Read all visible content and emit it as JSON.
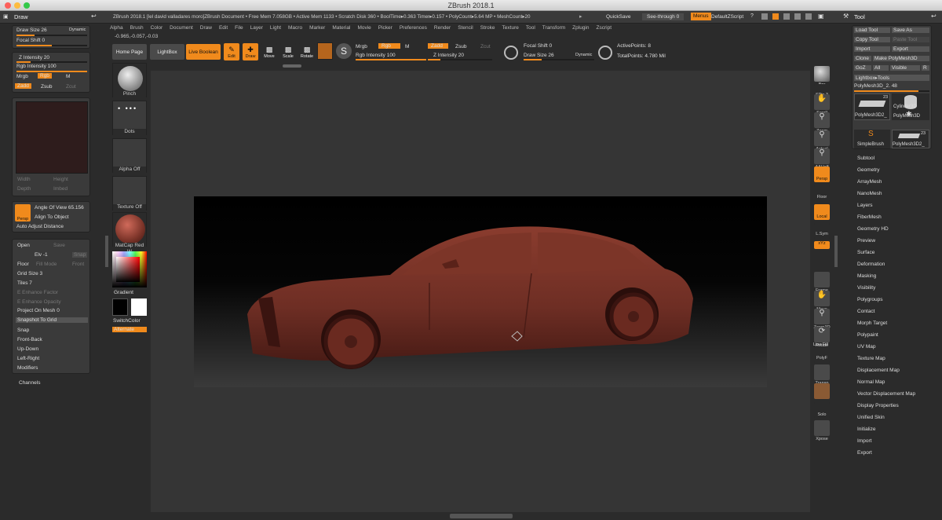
{
  "window": {
    "title": "ZBrush 2018.1"
  },
  "header": {
    "palette": "Draw",
    "info": "ZBrush 2018.1 [lel david valladares moro]ZBrush Document   • Free Mem 7.058GB • Active Mem 1133 • Scratch Disk 360 • BoolTime▸0.363 Timer▸0.157 • PolyCount▸5.64 MP • MeshCount▸20",
    "quicksave": "QuickSave",
    "seethrough": "See-through  0",
    "menus": "Menus",
    "script": "DefaultZScript",
    "tool": "Tool"
  },
  "menubar": [
    "Alpha",
    "Brush",
    "Color",
    "Document",
    "Draw",
    "Edit",
    "File",
    "Layer",
    "Light",
    "Macro",
    "Marker",
    "Material",
    "Movie",
    "Picker",
    "Preferences",
    "Render",
    "Stencil",
    "Stroke",
    "Texture",
    "Tool",
    "Transform",
    "Zplugin",
    "Zscript"
  ],
  "coords": "-0.965,-0.057,-0.03",
  "toolbar": {
    "home": "Home Page",
    "lightbox": "LightBox",
    "liveboolean": "Live Boolean",
    "edit": "Edit",
    "draw": "Draw",
    "move": "Move",
    "scale": "Scale",
    "rotate": "Rotate",
    "mrgb": "Mrgb",
    "rgb": "Rgb",
    "m": "M",
    "rgb_intensity": "Rgb Intensity 100",
    "zadd": "Zadd",
    "zsub": "Zsub",
    "zcut": "Zcut",
    "z_intensity": "Z Intensity 20",
    "focal_shift": "Focal Shift 0",
    "draw_size": "Draw Size 26",
    "dynamic": "Dynamic",
    "active_points": "ActivePoints: 8",
    "total_points": "TotalPoints: 4.780 Mil"
  },
  "left": {
    "draw_size": "Draw Size 26",
    "dynamic": "Dynamic",
    "focal_shift": "Focal Shift 0",
    "z_intensity": "Z Intensity 20",
    "rgb_intensity": "Rgb Intensity 100",
    "mrgb": "Mrgb",
    "rgb": "Rgb",
    "m": "M",
    "zadd": "Zadd",
    "zsub": "Zsub",
    "zcut": "Zcut",
    "width": "Width",
    "height": "Height",
    "depth": "Depth",
    "imbed": "Imbed",
    "persp": "Persp",
    "angle": "Angle Of View 65.156",
    "align": "Align To Object",
    "auto_adjust": "Auto Adjust Distance",
    "open": "Open",
    "save": "Save",
    "floor": "Floor",
    "elv": "Elv -1",
    "fill_mode": "Fill Mode",
    "front": "Front",
    "snap": "Snap",
    "grid_size": "Grid Size 3",
    "tiles": "Tiles 7",
    "enhance_factor": "E Enhance Factor",
    "enhance_opacity": "E Enhance Opacity",
    "project": "Project On Mesh 0",
    "snapshot": "Snapshot To Grid",
    "snap2": "Snap",
    "front_back": "Front-Back",
    "up_down": "Up-Down",
    "left_right": "Left-Right",
    "modifiers": "Modifiers",
    "channels": "Channels"
  },
  "brushes": {
    "pinch": "Pinch",
    "dots": "Dots",
    "alpha": "Alpha Off",
    "texture": "Texture Off",
    "matcap": "MatCap Red W",
    "gradient": "Gradient",
    "switchcolor": "SwitchColor",
    "alternate": "Alternate"
  },
  "rightbar": {
    "bpr": "Bpr",
    "spix": "SPix 3",
    "scroll": "Scroll",
    "zoom": "Zoom",
    "actual": "Actual",
    "aahalf": "AAHalf",
    "persp": "Persp",
    "floor": "Floor",
    "local": "Local",
    "lsym": "L.Sym",
    "xyz": "xYz",
    "frame": "Frame",
    "move": "Move",
    "zoom3d": "Zoom3D",
    "rotate": "Rotate",
    "polyf": "PolyF",
    "transp": "Transp",
    "solo": "Solo",
    "xpose": "Xpose",
    "linefill": "Line Fill"
  },
  "tool": {
    "load": "Load Tool",
    "saveas": "Save As",
    "copy": "Copy Tool",
    "paste": "Paste Tool",
    "import": "Import",
    "export": "Export",
    "clone": "Clone",
    "make": "Make PolyMesh3D",
    "goz": "GoZ",
    "all": "All",
    "visible": "Visible",
    "r": "R",
    "lightbox": "Lightbox▸Tools",
    "current": "PolyMesh3D_2. 48",
    "thumbs": [
      "PolyMesh3D2_",
      "Cylinder3D",
      "PolyMesh3D",
      "SimpleBrush",
      "PolyMesh3D2_"
    ],
    "n23a": "23",
    "n23b": "23",
    "items": [
      "Subtool",
      "Geometry",
      "ArrayMesh",
      "NanoMesh",
      "Layers",
      "FiberMesh",
      "Geometry HD",
      "Preview",
      "Surface",
      "Deformation",
      "Masking",
      "Visibility",
      "Polygroups",
      "Contact",
      "Morph Target",
      "Polypaint",
      "UV Map",
      "Texture Map",
      "Displacement Map",
      "Normal Map",
      "Vector Displacement Map",
      "Display Properties",
      "Unified Skin",
      "Initialize",
      "Import",
      "Export"
    ]
  },
  "colors": {
    "accent": "#f08a1c",
    "model": "#7a3328"
  }
}
